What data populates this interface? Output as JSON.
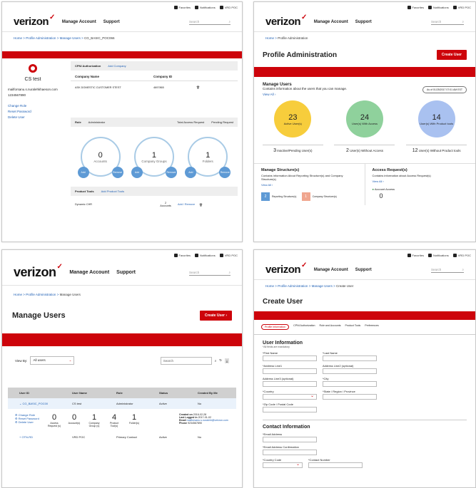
{
  "header": {
    "logo": "verizon",
    "nav_manage": "Manage Account",
    "nav_support": "Support",
    "search_placeholder": "Search",
    "util_favorites": "Favorites",
    "util_notifications": "Notifications",
    "util_user": "VRD POC"
  },
  "p1": {
    "crumb_home": "Home",
    "crumb_pa": "Profile Administration",
    "crumb_mu": "Manage Users",
    "crumb_cur": "CG_BASIC_POC066",
    "user_name": "CS test",
    "email": "mailforsanu.s.nuralehkhaeson.com",
    "phone": "1234567890",
    "links": [
      "Change Role",
      "Reset Password",
      "Delete User"
    ],
    "tab_cpni": "CPNI Authorization",
    "tab_add_company": "Add Company",
    "col_company": "Company Name",
    "col_id": "Company ID",
    "row_company": "ASK DOMESTIC CUSTOMER STEST",
    "row_id": "4697865",
    "role_label": "Role",
    "role_value": "Administrator",
    "total_access": "Total Access Request",
    "pending_request": "Pending Request",
    "circles": [
      {
        "n": "0",
        "label": "Accounts"
      },
      {
        "n": "1",
        "label": "Company Groups"
      },
      {
        "n": "1",
        "label": "Folders"
      }
    ],
    "add": "Add",
    "remove": "Remove",
    "tools_label": "Product Tools",
    "add_tools": "Add Product Tools",
    "tools_row": "Dynamic CHR",
    "tools_accounts": "2",
    "tools_accounts_label": "Accounts",
    "tools_add_remove": "Add / Remove"
  },
  "p2": {
    "crumb_home": "Home",
    "crumb_cur": "Profile Administration",
    "title": "Profile Administration",
    "create_btn": "Create User",
    "mu_title": "Manage Users",
    "mu_desc": "Contains information about the users that you can manage.",
    "view_all": "View All",
    "as_of": "As of 01/25/2017 07:01 AM EST",
    "bubbles": [
      {
        "n": "23",
        "label": "Active User(s)",
        "color": "#f7cd3c",
        "sub_n": "3",
        "sub": "Inactive/Pending User(s)"
      },
      {
        "n": "24",
        "label": "User(s) With Access",
        "color": "#8fd19c",
        "sub_n": "2",
        "sub": "User(s) Without Access"
      },
      {
        "n": "14",
        "label": "User(s) With Product tools",
        "color": "#a9c1f0",
        "sub_n": "12",
        "sub": "User(s) Without Product tools"
      }
    ],
    "ms_title": "Manage Structure(s)",
    "ms_desc": "Contains information About Reporting Structure(s) and Company Structure(s)",
    "rs_n": "2",
    "rs_label": "Reporting Structure(s)",
    "cs_n": "1",
    "cs_label": "Company Structure(s)",
    "ar_title": "Access Request(s)",
    "ar_desc": "Contains information about Access Request(s)",
    "ar_label": "Account Access",
    "ar_n": "0"
  },
  "p3": {
    "crumb_home": "Home",
    "crumb_pa": "Profile Administration",
    "crumb_cur": "Manage Users",
    "title": "Manage Users",
    "create_btn": "Create User",
    "view_by": "View By:",
    "view_by_value": "All users",
    "search": "Search",
    "cols": [
      "User ID",
      "User Name",
      "Role",
      "Status",
      "Created By Me"
    ],
    "row1": [
      "CG_BASIC_POC00",
      "CS test",
      "Administrator",
      "Active",
      "No"
    ],
    "links": [
      "Change Role",
      "Reset Password",
      "Delete User"
    ],
    "stats": [
      {
        "n": "0",
        "label": "Access Request (s)"
      },
      {
        "n": "0",
        "label": "Account(s)"
      },
      {
        "n": "1",
        "label": "Company Group (s)"
      },
      {
        "n": "4",
        "label": "Product Tool(s)"
      },
      {
        "n": "1",
        "label": "Folder(s)"
      }
    ],
    "created_on_label": "Created on",
    "created_on": "2016-02-28",
    "last_logged_label": "Last Logged in",
    "last_logged": "2017-01-02",
    "email_label": "Email",
    "email": "mailforsanu.s.nuralehi@verizon.com",
    "phone_label": "Phone",
    "phone": "9234567890",
    "row2": [
      "OTN-RD",
      "VRD POC",
      "Primary Contact",
      "Active",
      "No"
    ]
  },
  "p4": {
    "crumb_home": "Home",
    "crumb_pa": "Profile Administration",
    "crumb_mu": "Manage Users",
    "crumb_cur": "Create User",
    "title": "Create User",
    "steps": [
      "Profile Information",
      "CPNI Authorization",
      "Role and Accounts",
      "Product Tools",
      "Preferences"
    ],
    "ui_title": "User Information",
    "ui_note": "*All fields are mandatory",
    "f_first": "*First Name",
    "f_last": "*Last Name",
    "f_addr1": "*Address Line1",
    "f_addr2": "Address Line2 (optional)",
    "f_addr3": "Address Line3 (optional)",
    "f_city": "*City",
    "f_country": "*Country",
    "f_state": "*State / Region / Province",
    "f_zip": "*Zip Code / Postal Code",
    "ci_title": "Contact Information",
    "f_email": "*Email Address",
    "f_email_conf": "*Email Address Confirmation",
    "f_cc": "*Country Code",
    "f_contact": "*Contact Number"
  }
}
